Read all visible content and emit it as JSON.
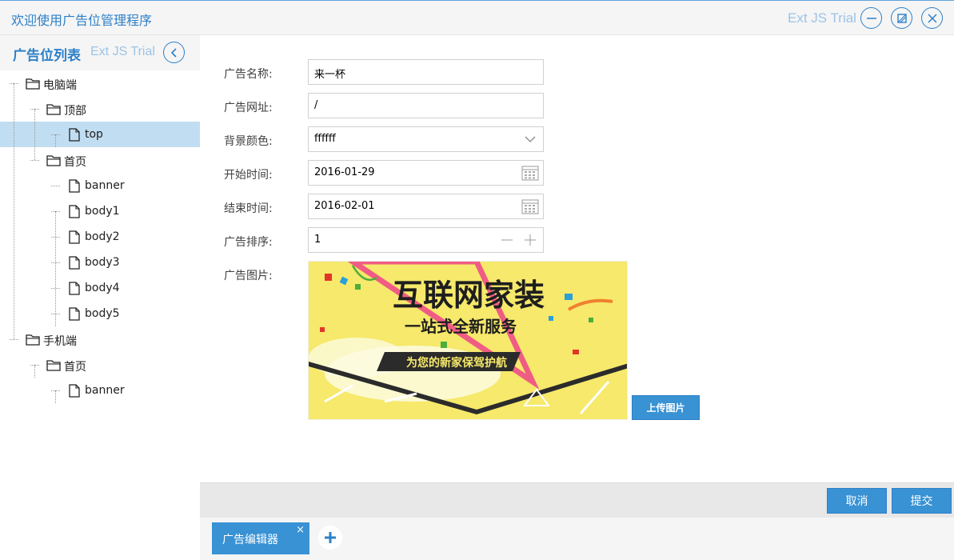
{
  "window": {
    "title": "欢迎使用广告位管理程序",
    "watermark": "Ext JS Trial",
    "tools": [
      "minimize-icon",
      "restore-icon",
      "close-icon"
    ]
  },
  "left_panel": {
    "title": "广告位列表",
    "watermark": "Ext JS Trial",
    "collapse_icon": "chevron-left-icon",
    "tree": [
      {
        "label": "电脑端",
        "type": "folder",
        "depth": 0
      },
      {
        "label": "顶部",
        "type": "folder",
        "depth": 1
      },
      {
        "label": "top",
        "type": "leaf",
        "depth": 2,
        "selected": true
      },
      {
        "label": "首页",
        "type": "folder",
        "depth": 1
      },
      {
        "label": "banner",
        "type": "leaf",
        "depth": 2
      },
      {
        "label": "body1",
        "type": "leaf",
        "depth": 2
      },
      {
        "label": "body2",
        "type": "leaf",
        "depth": 2
      },
      {
        "label": "body3",
        "type": "leaf",
        "depth": 2
      },
      {
        "label": "body4",
        "type": "leaf",
        "depth": 2
      },
      {
        "label": "body5",
        "type": "leaf",
        "depth": 2
      },
      {
        "label": "手机端",
        "type": "folder",
        "depth": 0
      },
      {
        "label": "首页",
        "type": "folder",
        "depth": 1
      },
      {
        "label": "banner",
        "type": "leaf",
        "depth": 2
      }
    ]
  },
  "form": {
    "name": {
      "label": "广告名称:",
      "value": "来一杯"
    },
    "url": {
      "label": "广告网址:",
      "value": "/"
    },
    "bg_color": {
      "label": "背景颜色:",
      "value": "ffffff"
    },
    "start_time": {
      "label": "开始时间:",
      "value": "2016-01-29"
    },
    "end_time": {
      "label": "结束时间:",
      "value": "2016-02-01"
    },
    "order": {
      "label": "广告排序:",
      "value": "1"
    },
    "image": {
      "label": "广告图片:",
      "banner_title": "互联网家装",
      "banner_subtitle": "一站式全新服务",
      "banner_tagline": "为您的新家保驾护航"
    },
    "upload_button": "上传图片"
  },
  "toolbar": {
    "cancel": "取消",
    "submit": "提交"
  },
  "tabs": {
    "items": [
      {
        "label": "广告编辑器",
        "close": "×"
      }
    ],
    "add_icon": "plus-icon"
  },
  "colors": {
    "accent": "#3892d4",
    "title": "#2d80c8",
    "selected_row": "#c1ddf1",
    "watermark": "#9cc3e6"
  }
}
